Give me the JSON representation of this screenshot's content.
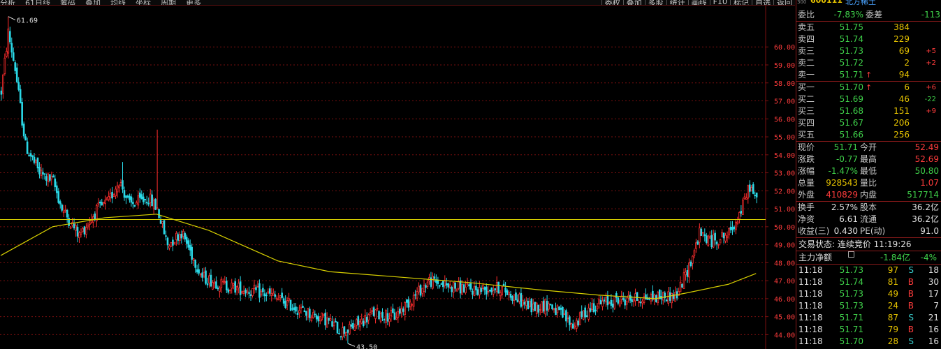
{
  "topbar": {
    "left_items": [
      "分析",
      "61日线",
      "筹码",
      "叠加",
      "均线",
      "坐标",
      "周期",
      "更多"
    ],
    "right_items": [
      "委权",
      "叠加",
      "多股",
      "统计",
      "画线",
      "F10",
      "标记",
      "自选",
      "返回"
    ]
  },
  "chart_icons": [
    "◇",
    "▭"
  ],
  "chart_data": {
    "type": "candlestick",
    "y_ticks": [
      "60.00",
      "59.00",
      "58.00",
      "57.00",
      "56.00",
      "55.00",
      "54.00",
      "53.00",
      "52.00",
      "51.00",
      "50.00",
      "49.00",
      "48.00",
      "47.00",
      "46.00",
      "45.00",
      "44.00"
    ],
    "y_range": [
      43.2,
      62.3
    ],
    "high_marker": "61.69",
    "low_marker": "43.50",
    "reference_line": 50.4,
    "colors": {
      "up": "#ff2d2d",
      "down": "#2ad8e6",
      "ma": "#d8d000",
      "grid": "#7a0f0f",
      "axis_text": "#ff3c3c"
    },
    "segments": [
      [
        0,
        57.5
      ],
      [
        4,
        60.8
      ],
      [
        8,
        58.8
      ],
      [
        14,
        54.5
      ],
      [
        22,
        53.0
      ],
      [
        30,
        52.5
      ],
      [
        35,
        51.0
      ],
      [
        45,
        49.5
      ],
      [
        55,
        50.9
      ],
      [
        62,
        51.4
      ],
      [
        68,
        52.6
      ],
      [
        74,
        51.2
      ],
      [
        85,
        51.6
      ],
      [
        90,
        51.0
      ],
      [
        96,
        49.0
      ],
      [
        104,
        49.7
      ],
      [
        116,
        47.2
      ],
      [
        130,
        46.7
      ],
      [
        141,
        46.5
      ],
      [
        155,
        46.2
      ],
      [
        172,
        45.4
      ],
      [
        188,
        44.8
      ],
      [
        196,
        44.2
      ],
      [
        201,
        44.3
      ],
      [
        215,
        45.2
      ],
      [
        227,
        45.0
      ],
      [
        233,
        45.6
      ],
      [
        247,
        47.0
      ],
      [
        258,
        46.7
      ],
      [
        272,
        46.5
      ],
      [
        288,
        46.6
      ],
      [
        306,
        45.5
      ],
      [
        316,
        45.7
      ],
      [
        330,
        44.5
      ],
      [
        341,
        45.6
      ],
      [
        355,
        45.9
      ],
      [
        366,
        46.0
      ],
      [
        379,
        46.1
      ],
      [
        390,
        46.2
      ],
      [
        397,
        47.8
      ],
      [
        403,
        49.6
      ],
      [
        410,
        49.2
      ],
      [
        420,
        49.6
      ],
      [
        427,
        50.9
      ],
      [
        432,
        52.3
      ],
      [
        436,
        51.4
      ]
    ],
    "spikes": {
      "4": 61.69,
      "200": 43.5,
      "90": 55.4,
      "70": 53.6,
      "320": 45.2
    },
    "ma_points": [
      [
        0,
        48.4
      ],
      [
        30,
        50.0
      ],
      [
        60,
        50.5
      ],
      [
        90,
        50.7
      ],
      [
        120,
        49.8
      ],
      [
        160,
        48.1
      ],
      [
        190,
        47.5
      ],
      [
        230,
        47.2
      ],
      [
        270,
        46.9
      ],
      [
        310,
        46.5
      ],
      [
        345,
        46.2
      ],
      [
        378,
        46.0
      ],
      [
        395,
        46.3
      ],
      [
        420,
        46.8
      ],
      [
        436,
        47.4
      ]
    ]
  },
  "panel": {
    "code": "600111",
    "name": "北方稀土",
    "header_small": "300",
    "weibi_label": "委比",
    "weibi_value": "-7.83%",
    "weicha_label": "委差",
    "weicha_value": "-113",
    "asks": [
      {
        "label": "卖五",
        "price": "51.75",
        "arrow": "",
        "vol": "384",
        "chg": ""
      },
      {
        "label": "卖四",
        "price": "51.74",
        "arrow": "",
        "vol": "229",
        "chg": ""
      },
      {
        "label": "卖三",
        "price": "51.73",
        "arrow": "",
        "vol": "69",
        "chg": "+5"
      },
      {
        "label": "卖二",
        "price": "51.72",
        "arrow": "",
        "vol": "2",
        "chg": "+2"
      },
      {
        "label": "卖一",
        "price": "51.71",
        "arrow": "↑",
        "vol": "94",
        "chg": ""
      }
    ],
    "bids": [
      {
        "label": "买一",
        "price": "51.70",
        "arrow": "↑",
        "vol": "6",
        "chg": "+6",
        "chgc": "r"
      },
      {
        "label": "买二",
        "price": "51.69",
        "arrow": "",
        "vol": "46",
        "chg": "-22",
        "chgc": "g"
      },
      {
        "label": "买三",
        "price": "51.68",
        "arrow": "",
        "vol": "151",
        "chg": "+9",
        "chgc": "r"
      },
      {
        "label": "买四",
        "price": "51.67",
        "arrow": "",
        "vol": "206",
        "chg": "",
        "chgc": "r"
      },
      {
        "label": "买五",
        "price": "51.66",
        "arrow": "",
        "vol": "256",
        "chg": "",
        "chgc": "r"
      }
    ],
    "quotes": [
      {
        "k1": "现价",
        "v1": "51.71",
        "c1": "g",
        "k2": "今开",
        "v2": "52.49",
        "c2": "r"
      },
      {
        "k1": "涨跌",
        "v1": "-0.77",
        "c1": "g",
        "k2": "最高",
        "v2": "52.69",
        "c2": "r"
      },
      {
        "k1": "涨幅",
        "v1": "-1.47%",
        "c1": "g",
        "k2": "最低",
        "v2": "50.80",
        "c2": "g"
      },
      {
        "k1": "总量",
        "v1": "928543",
        "c1": "y",
        "k2": "量比",
        "v2": "1.07",
        "c2": "r"
      },
      {
        "k1": "外盘",
        "v1": "410829",
        "c1": "r",
        "k2": "内盘",
        "v2": "517714",
        "c2": "g"
      }
    ],
    "stats": [
      {
        "k1": "换手",
        "v1": "2.57%",
        "k2": "股本",
        "v2": "36.2亿"
      },
      {
        "k1": "净资",
        "v1": "6.61",
        "k2": "流通",
        "v2": "36.2亿"
      },
      {
        "k1": "收益(三)",
        "v1": "0.430",
        "k2": "PE(动)",
        "v2": "91.0"
      }
    ],
    "trade_status": "交易状态: 连续竞价 11:19:26",
    "main_net_label": "主力净额",
    "main_net_value": "-1.84亿",
    "main_net_pct": "-4%",
    "ticks": [
      {
        "time": "11:18",
        "price": "51.73",
        "vol": "97",
        "bs": "S",
        "n": "18"
      },
      {
        "time": "11:18",
        "price": "51.74",
        "vol": "81",
        "bs": "B",
        "n": "30"
      },
      {
        "time": "11:18",
        "price": "51.73",
        "vol": "49",
        "bs": "B",
        "n": "17"
      },
      {
        "time": "11:18",
        "price": "51.73",
        "vol": "24",
        "bs": "B",
        "n": "7"
      },
      {
        "time": "11:18",
        "price": "51.71",
        "vol": "87",
        "bs": "S",
        "n": "21"
      },
      {
        "time": "11:18",
        "price": "51.71",
        "vol": "79",
        "bs": "B",
        "n": "16"
      },
      {
        "time": "11:18",
        "price": "51.70",
        "vol": "28",
        "bs": "S",
        "n": "16"
      },
      {
        "time": "11:18",
        "price": "51.70",
        "vol": "29",
        "bs": "S",
        "n": "10"
      }
    ]
  }
}
